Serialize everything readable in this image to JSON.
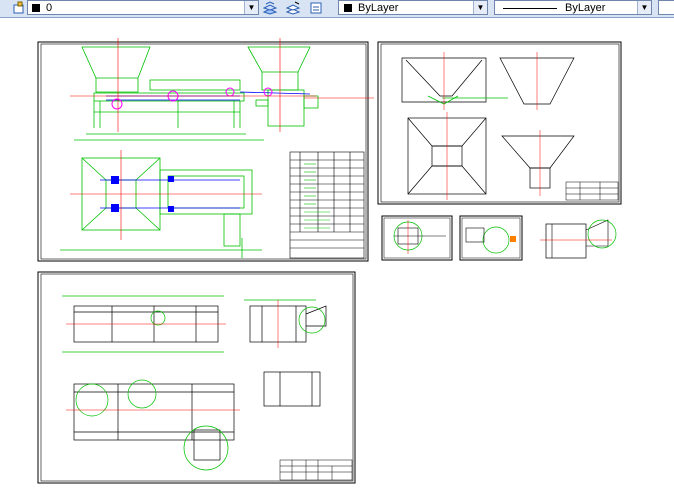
{
  "toolbar": {
    "layer_combo": {
      "value": "0",
      "swatch_color": "#000000"
    },
    "color_combo": {
      "value": "ByLayer",
      "swatch_color": "#000000"
    },
    "linetype_combo": {
      "value": "ByLayer"
    },
    "icons": [
      "layer-properties-icon",
      "layer-previous-icon",
      "layer-states-icon",
      "make-object-layer-icon"
    ]
  },
  "colors": {
    "frame": "#000000",
    "green": "#00c000",
    "blue": "#0000ff",
    "red": "#ff0000",
    "magenta": "#ff00ff",
    "cyan": "#00b4b4"
  }
}
